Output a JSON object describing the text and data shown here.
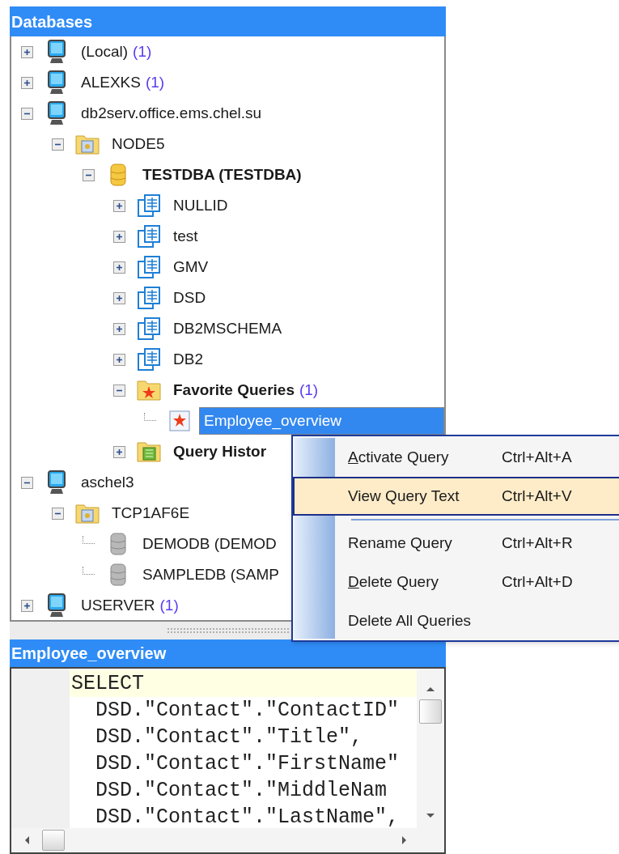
{
  "databases_panel": {
    "title": "Databases",
    "tree": [
      {
        "label": "(Local)",
        "count": "(1)",
        "kind": "computer",
        "expanded": false
      },
      {
        "label": "ALEXKS",
        "count": "(1)",
        "kind": "computer",
        "expanded": false
      },
      {
        "label": "db2serv.office.ems.chel.su",
        "kind": "computer",
        "expanded": true,
        "children": [
          {
            "label": "NODE5",
            "kind": "node",
            "expanded": true,
            "children": [
              {
                "label": "TESTDBA (TESTDBA)",
                "bold": true,
                "kind": "database-active",
                "expanded": true,
                "children": [
                  {
                    "label": "NULLID",
                    "kind": "schema",
                    "expanded": false
                  },
                  {
                    "label": "test",
                    "kind": "schema",
                    "expanded": false
                  },
                  {
                    "label": "GMV",
                    "kind": "schema",
                    "expanded": false
                  },
                  {
                    "label": "DSD",
                    "kind": "schema",
                    "expanded": false
                  },
                  {
                    "label": "DB2MSCHEMA",
                    "kind": "schema",
                    "expanded": false
                  },
                  {
                    "label": "DB2",
                    "kind": "schema",
                    "expanded": false
                  },
                  {
                    "label": "Favorite Queries",
                    "count": "(1)",
                    "bold": true,
                    "kind": "favorites",
                    "expanded": true,
                    "children": [
                      {
                        "label": "Employee_overview",
                        "kind": "favorite-query",
                        "selected": true
                      }
                    ]
                  },
                  {
                    "label": "Query Histor",
                    "bold": true,
                    "kind": "history",
                    "expanded": false
                  }
                ]
              }
            ]
          }
        ]
      },
      {
        "label": "aschel3",
        "kind": "computer",
        "expanded": true,
        "children": [
          {
            "label": "TCP1AF6E",
            "kind": "node",
            "expanded": true,
            "children": [
              {
                "label": "DEMODB (DEMOD",
                "kind": "database",
                "selected": false
              },
              {
                "label": "SAMPLEDB (SAMP",
                "kind": "database",
                "selected": false
              }
            ]
          }
        ]
      },
      {
        "label": "USERVER",
        "count": "(1)",
        "kind": "computer",
        "expanded": false
      }
    ]
  },
  "context_menu": [
    {
      "kind": "item",
      "label": "Activate Query",
      "underline_first": true,
      "shortcut": "Ctrl+Alt+A",
      "selected": false
    },
    {
      "kind": "item",
      "label": "View Query Text",
      "underline_first": false,
      "shortcut": "Ctrl+Alt+V",
      "selected": true
    },
    {
      "kind": "separator"
    },
    {
      "kind": "item",
      "label": "Rename Query",
      "underline_first": false,
      "shortcut": "Ctrl+Alt+R",
      "selected": false
    },
    {
      "kind": "item",
      "label": "Delete Query",
      "underline_first": true,
      "shortcut": "Ctrl+Alt+D",
      "selected": false
    },
    {
      "kind": "item",
      "label": "Delete All Queries",
      "underline_first": false,
      "selected": false
    }
  ],
  "query_panel": {
    "title": "Employee_overview",
    "lines": [
      {
        "text": "SELECT",
        "current": true
      },
      {
        "text": "  DSD.\"Contact\".\"ContactID\"",
        "current": false
      },
      {
        "text": "  DSD.\"Contact\".\"Title\",",
        "current": false
      },
      {
        "text": "  DSD.\"Contact\".\"FirstName\"",
        "current": false
      },
      {
        "text": "  DSD.\"Contact\".\"MiddleNam",
        "current": false
      },
      {
        "text": "  DSD.\"Contact\".\"LastName\",",
        "current": false
      }
    ]
  }
}
